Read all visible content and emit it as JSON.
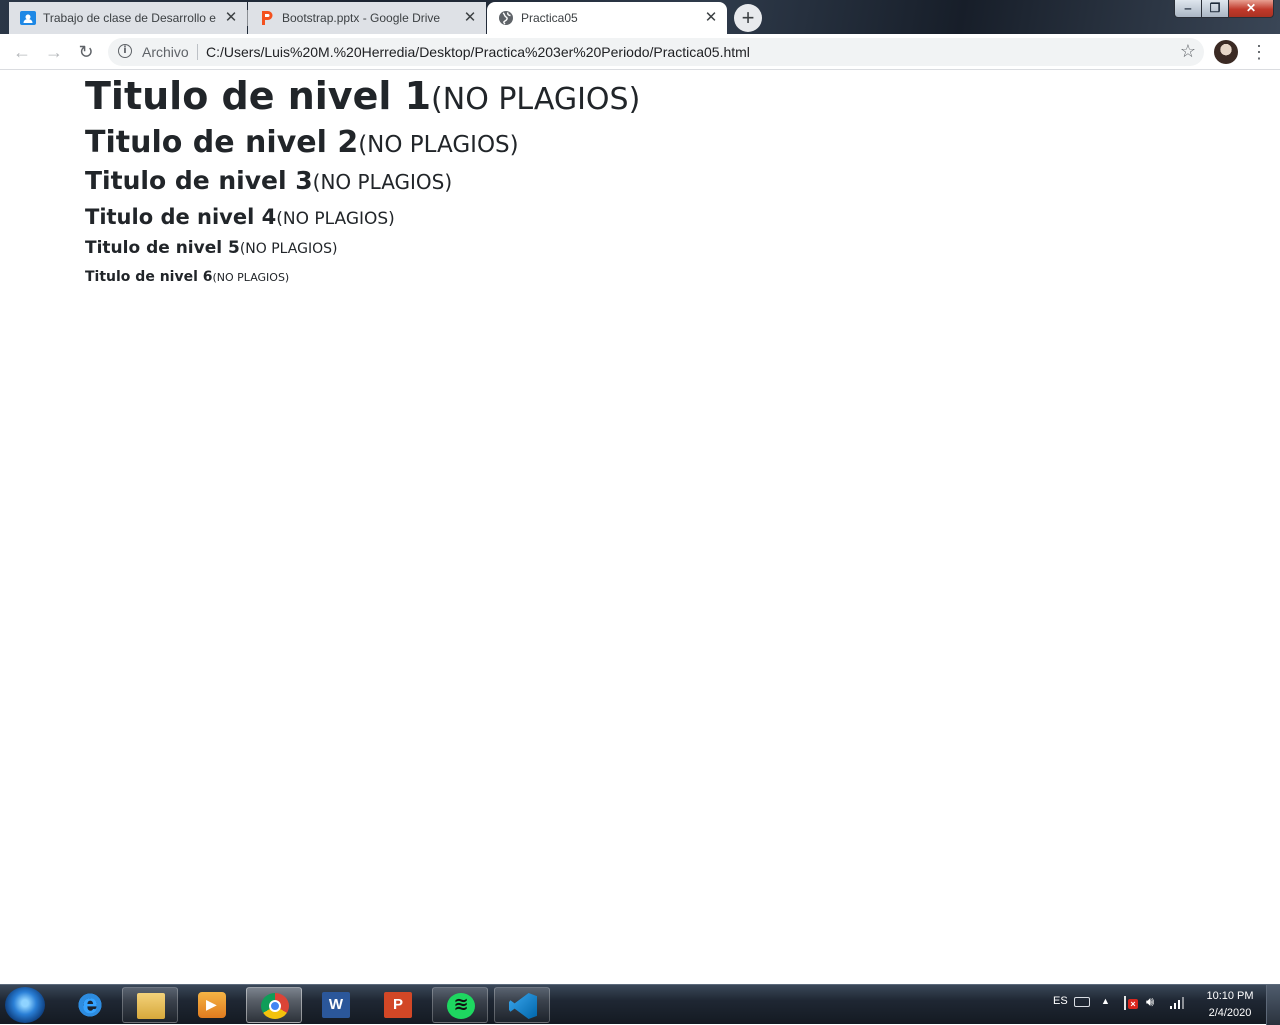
{
  "browser": {
    "tabs": [
      {
        "title": "Trabajo de clase de Desarrollo e I",
        "favicon": "google-classroom-icon",
        "active": false
      },
      {
        "title": "Bootstrap.pptx - Google Drive",
        "favicon": "powerpoint-icon",
        "active": false
      },
      {
        "title": "Practica05",
        "favicon": "globe-icon",
        "active": true
      }
    ],
    "close_glyph": "✕",
    "new_tab_glyph": "+",
    "omnibox": {
      "scheme_label": "Archivo",
      "url": "C:/Users/Luis%20M.%20Herredia/Desktop/Practica%203er%20Periodo/Practica05.html"
    }
  },
  "page": {
    "headings": [
      {
        "level": 1,
        "text": "Titulo de nivel 1",
        "small": "(NO PLAGIOS)"
      },
      {
        "level": 2,
        "text": "Titulo de nivel 2",
        "small": "(NO PLAGIOS)"
      },
      {
        "level": 3,
        "text": "Titulo de nivel 3",
        "small": "(NO PLAGIOS)"
      },
      {
        "level": 4,
        "text": "Titulo de nivel 4",
        "small": "(NO PLAGIOS)"
      },
      {
        "level": 5,
        "text": "Titulo de nivel 5",
        "small": "(NO PLAGIOS)"
      },
      {
        "level": 6,
        "text": "Titulo de nivel 6",
        "small": "(NO PLAGIOS)"
      }
    ]
  },
  "taskbar": {
    "items": [
      "internet-explorer",
      "windows-explorer",
      "media-player",
      "chrome",
      "word",
      "powerpoint",
      "spotify",
      "vscode"
    ],
    "active_item": "chrome",
    "tray": {
      "language": "ES",
      "time": "10:10 PM",
      "date": "2/4/2020"
    }
  },
  "colors": {
    "heading_text": "#212529",
    "tab_strip": "#202b3a",
    "active_tab": "#ffffff",
    "inactive_tab": "#dee1e6"
  }
}
